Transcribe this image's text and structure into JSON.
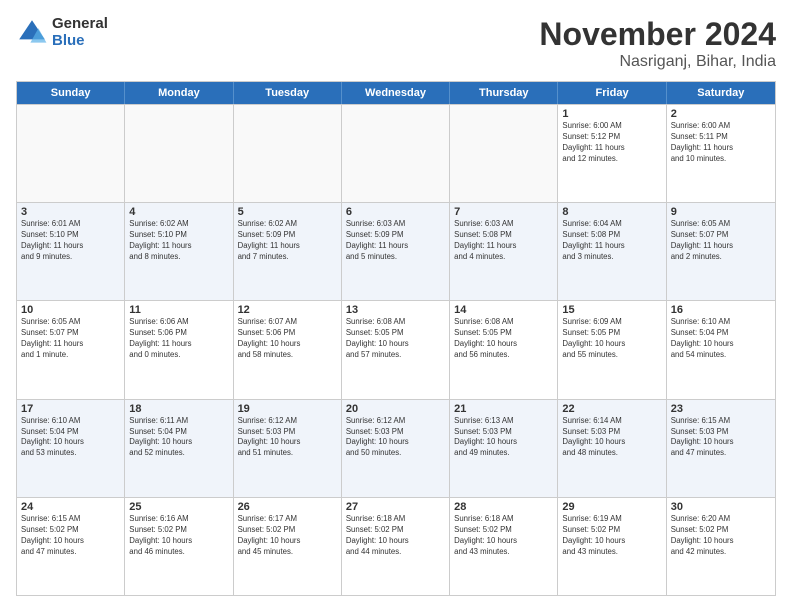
{
  "logo": {
    "general": "General",
    "blue": "Blue"
  },
  "title": "November 2024",
  "location": "Nasriganj, Bihar, India",
  "days_header": [
    "Sunday",
    "Monday",
    "Tuesday",
    "Wednesday",
    "Thursday",
    "Friday",
    "Saturday"
  ],
  "weeks": [
    [
      {
        "day": "",
        "info": "",
        "empty": true
      },
      {
        "day": "",
        "info": "",
        "empty": true
      },
      {
        "day": "",
        "info": "",
        "empty": true
      },
      {
        "day": "",
        "info": "",
        "empty": true
      },
      {
        "day": "",
        "info": "",
        "empty": true
      },
      {
        "day": "1",
        "info": "Sunrise: 6:00 AM\nSunset: 5:12 PM\nDaylight: 11 hours\nand 12 minutes."
      },
      {
        "day": "2",
        "info": "Sunrise: 6:00 AM\nSunset: 5:11 PM\nDaylight: 11 hours\nand 10 minutes."
      }
    ],
    [
      {
        "day": "3",
        "info": "Sunrise: 6:01 AM\nSunset: 5:10 PM\nDaylight: 11 hours\nand 9 minutes."
      },
      {
        "day": "4",
        "info": "Sunrise: 6:02 AM\nSunset: 5:10 PM\nDaylight: 11 hours\nand 8 minutes."
      },
      {
        "day": "5",
        "info": "Sunrise: 6:02 AM\nSunset: 5:09 PM\nDaylight: 11 hours\nand 7 minutes."
      },
      {
        "day": "6",
        "info": "Sunrise: 6:03 AM\nSunset: 5:09 PM\nDaylight: 11 hours\nand 5 minutes."
      },
      {
        "day": "7",
        "info": "Sunrise: 6:03 AM\nSunset: 5:08 PM\nDaylight: 11 hours\nand 4 minutes."
      },
      {
        "day": "8",
        "info": "Sunrise: 6:04 AM\nSunset: 5:08 PM\nDaylight: 11 hours\nand 3 minutes."
      },
      {
        "day": "9",
        "info": "Sunrise: 6:05 AM\nSunset: 5:07 PM\nDaylight: 11 hours\nand 2 minutes."
      }
    ],
    [
      {
        "day": "10",
        "info": "Sunrise: 6:05 AM\nSunset: 5:07 PM\nDaylight: 11 hours\nand 1 minute."
      },
      {
        "day": "11",
        "info": "Sunrise: 6:06 AM\nSunset: 5:06 PM\nDaylight: 11 hours\nand 0 minutes."
      },
      {
        "day": "12",
        "info": "Sunrise: 6:07 AM\nSunset: 5:06 PM\nDaylight: 10 hours\nand 58 minutes."
      },
      {
        "day": "13",
        "info": "Sunrise: 6:08 AM\nSunset: 5:05 PM\nDaylight: 10 hours\nand 57 minutes."
      },
      {
        "day": "14",
        "info": "Sunrise: 6:08 AM\nSunset: 5:05 PM\nDaylight: 10 hours\nand 56 minutes."
      },
      {
        "day": "15",
        "info": "Sunrise: 6:09 AM\nSunset: 5:05 PM\nDaylight: 10 hours\nand 55 minutes."
      },
      {
        "day": "16",
        "info": "Sunrise: 6:10 AM\nSunset: 5:04 PM\nDaylight: 10 hours\nand 54 minutes."
      }
    ],
    [
      {
        "day": "17",
        "info": "Sunrise: 6:10 AM\nSunset: 5:04 PM\nDaylight: 10 hours\nand 53 minutes."
      },
      {
        "day": "18",
        "info": "Sunrise: 6:11 AM\nSunset: 5:04 PM\nDaylight: 10 hours\nand 52 minutes."
      },
      {
        "day": "19",
        "info": "Sunrise: 6:12 AM\nSunset: 5:03 PM\nDaylight: 10 hours\nand 51 minutes."
      },
      {
        "day": "20",
        "info": "Sunrise: 6:12 AM\nSunset: 5:03 PM\nDaylight: 10 hours\nand 50 minutes."
      },
      {
        "day": "21",
        "info": "Sunrise: 6:13 AM\nSunset: 5:03 PM\nDaylight: 10 hours\nand 49 minutes."
      },
      {
        "day": "22",
        "info": "Sunrise: 6:14 AM\nSunset: 5:03 PM\nDaylight: 10 hours\nand 48 minutes."
      },
      {
        "day": "23",
        "info": "Sunrise: 6:15 AM\nSunset: 5:03 PM\nDaylight: 10 hours\nand 47 minutes."
      }
    ],
    [
      {
        "day": "24",
        "info": "Sunrise: 6:15 AM\nSunset: 5:02 PM\nDaylight: 10 hours\nand 47 minutes."
      },
      {
        "day": "25",
        "info": "Sunrise: 6:16 AM\nSunset: 5:02 PM\nDaylight: 10 hours\nand 46 minutes."
      },
      {
        "day": "26",
        "info": "Sunrise: 6:17 AM\nSunset: 5:02 PM\nDaylight: 10 hours\nand 45 minutes."
      },
      {
        "day": "27",
        "info": "Sunrise: 6:18 AM\nSunset: 5:02 PM\nDaylight: 10 hours\nand 44 minutes."
      },
      {
        "day": "28",
        "info": "Sunrise: 6:18 AM\nSunset: 5:02 PM\nDaylight: 10 hours\nand 43 minutes."
      },
      {
        "day": "29",
        "info": "Sunrise: 6:19 AM\nSunset: 5:02 PM\nDaylight: 10 hours\nand 43 minutes."
      },
      {
        "day": "30",
        "info": "Sunrise: 6:20 AM\nSunset: 5:02 PM\nDaylight: 10 hours\nand 42 minutes."
      }
    ]
  ]
}
